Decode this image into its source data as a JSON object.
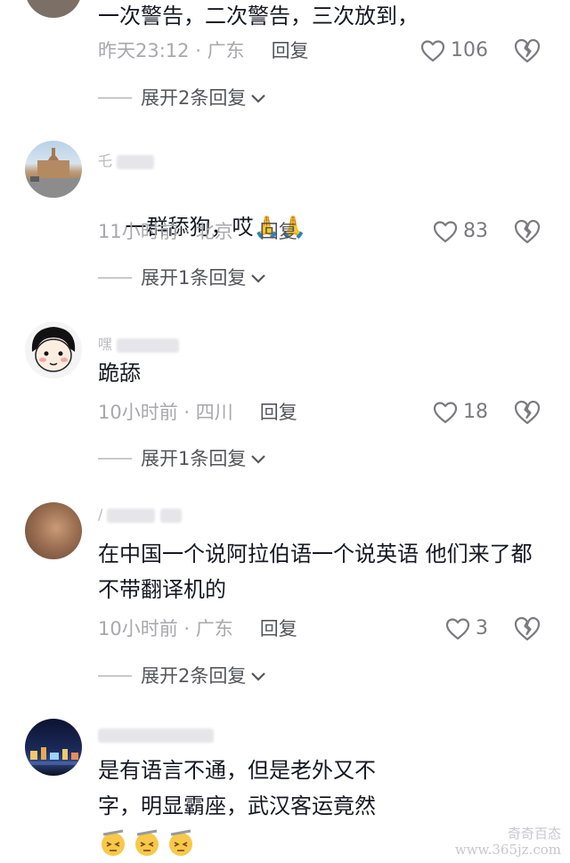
{
  "comments": [
    {
      "text": "一次警告，二次警告，三次放到，",
      "time": "昨天23:12",
      "location": "广东",
      "reply_label": "回复",
      "likes": "106",
      "expand_label": "展开2条回复"
    },
    {
      "username": "乇",
      "text": "一群舔狗，哎🙏🙏",
      "time": "11小时前",
      "location": "北京",
      "reply_label": "回复",
      "likes": "83",
      "expand_label": "展开1条回复"
    },
    {
      "username": "嘿",
      "text": "跪舔",
      "time": "10小时前",
      "location": "四川",
      "reply_label": "回复",
      "likes": "18",
      "expand_label": "展开1条回复"
    },
    {
      "username": "/",
      "text": "在中国一个说阿拉伯语一个说英语 他们来了都不带翻译机的",
      "time": "10小时前",
      "location": "广东",
      "reply_label": "回复",
      "likes": "3",
      "expand_label": "展开2条回复"
    },
    {
      "text": "是有语言不通，但是老外又不\n字，明显霸座，武汉客运竟然"
    }
  ],
  "meta_separator": " · ",
  "watermark": {
    "brand": "奇奇百态",
    "url": "www.365jz.com"
  },
  "colors": {
    "text": "#161823",
    "meta": "#a8a8ad",
    "reply": "#55565c"
  }
}
